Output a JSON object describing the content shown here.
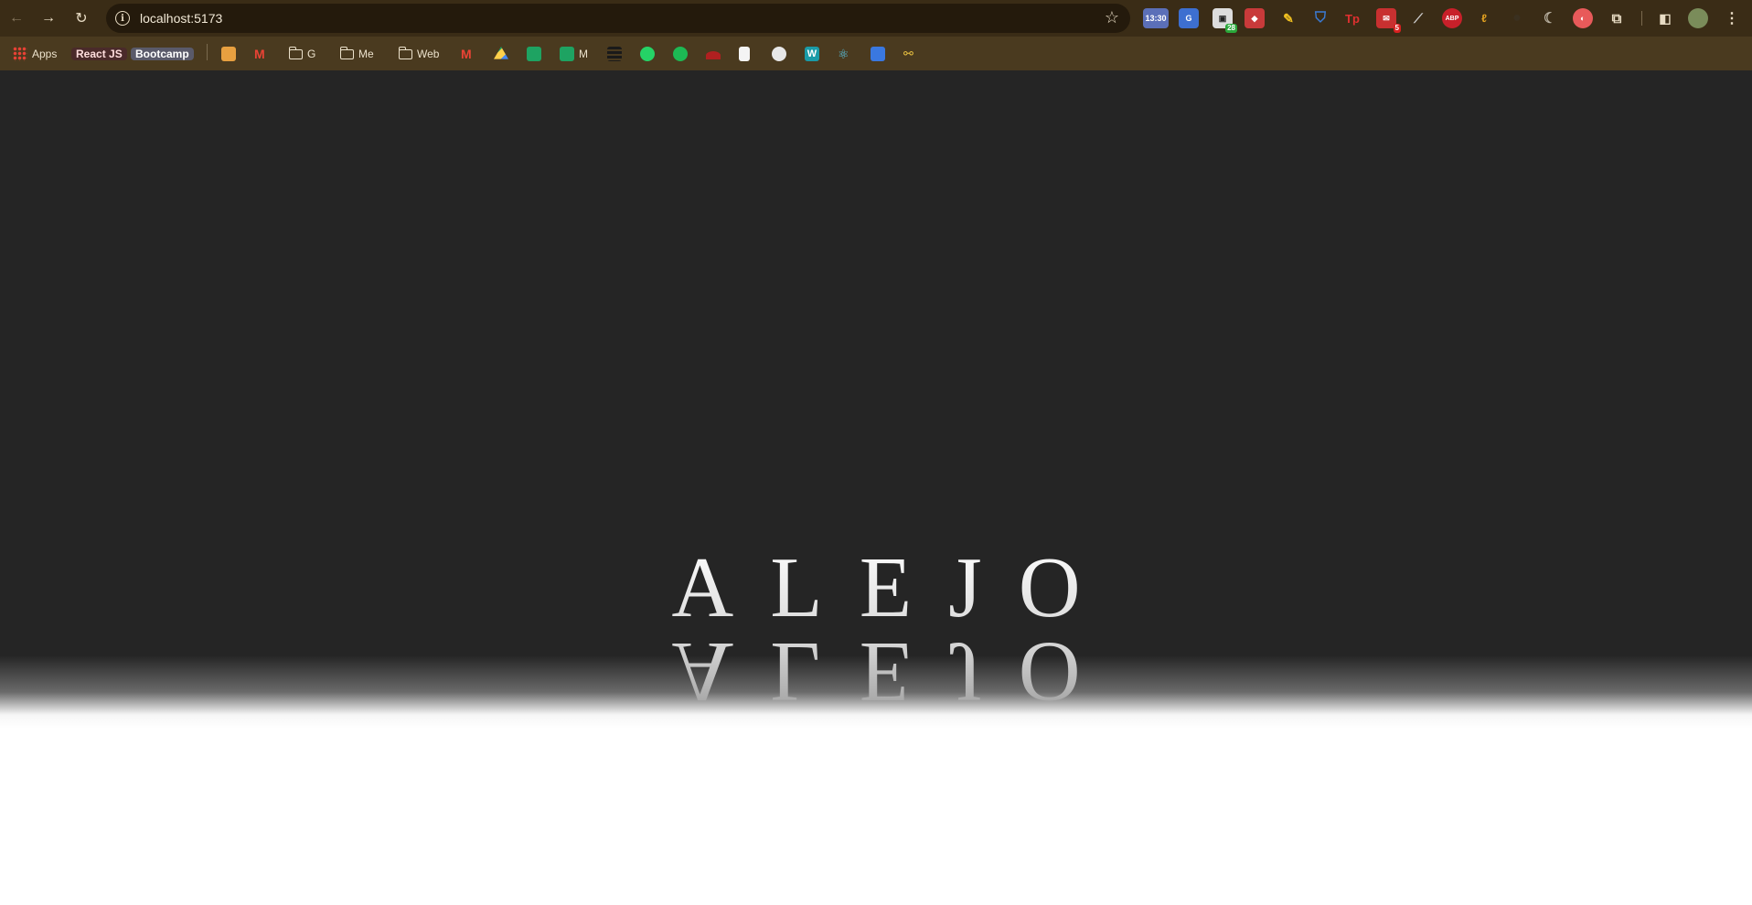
{
  "browser": {
    "url": "localhost:5173",
    "bookmarks": {
      "apps": "Apps",
      "react": "React JS",
      "bootcamp": "Bootcamp",
      "folder_g": "G",
      "folder_me": "Me",
      "folder_web": "Web",
      "sheets_m": "M"
    },
    "extensions": {
      "clock_time": "13:30",
      "counter_badge": "28",
      "mail_badge": "5",
      "tp_label": "Tp",
      "abp_label": "ABP"
    }
  },
  "page": {
    "hero_text": "ALEJO"
  },
  "colors": {
    "chrome_toolbar": "#3a2c16",
    "bookmarks_bar": "#4a3a1f",
    "page_background": "#252525"
  }
}
